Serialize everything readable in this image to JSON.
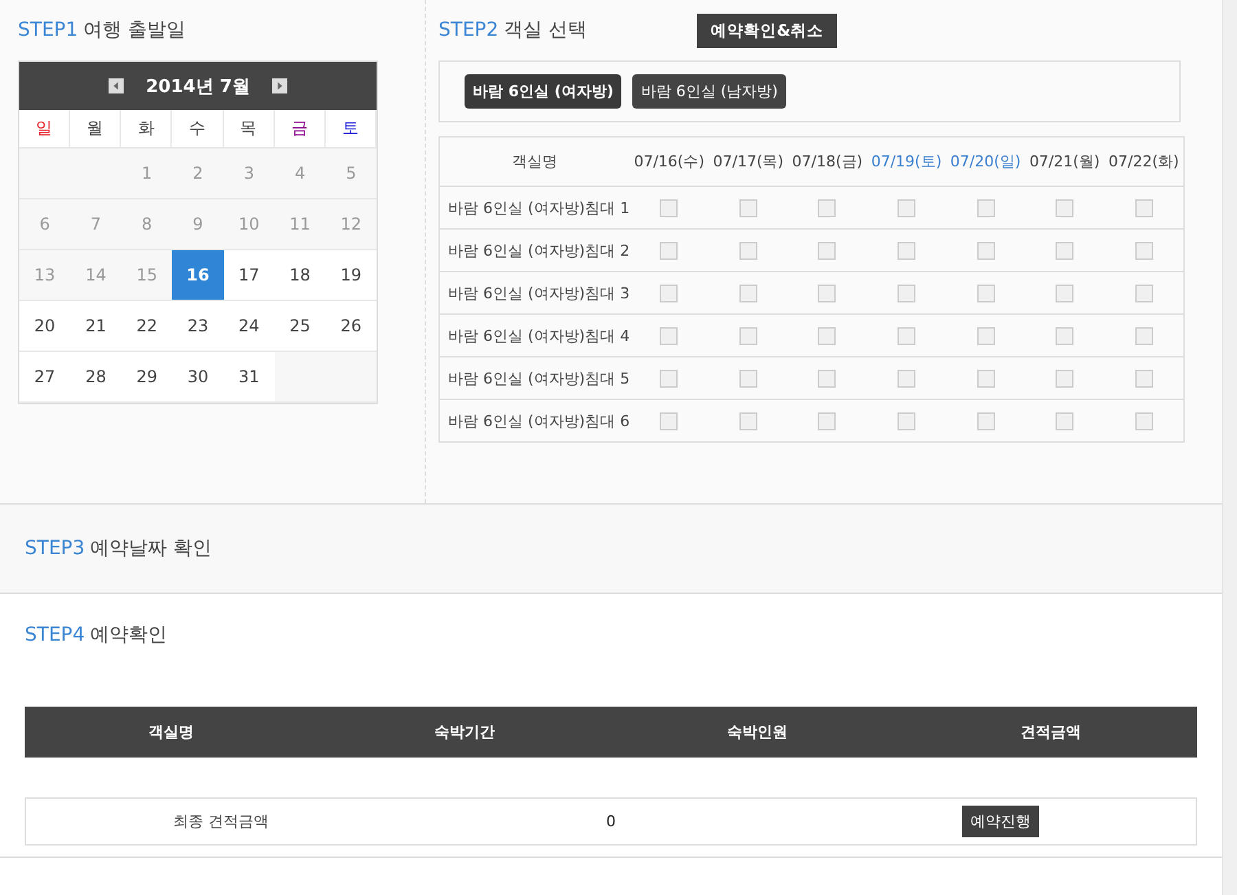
{
  "step1": {
    "step": "STEP1",
    "title": "여행 출발일",
    "calendar": {
      "month": "2014년 7월",
      "weekdays": [
        {
          "label": "일",
          "color": "#e8202a"
        },
        {
          "label": "월",
          "color": "#444444"
        },
        {
          "label": "화",
          "color": "#444444"
        },
        {
          "label": "수",
          "color": "#444444"
        },
        {
          "label": "목",
          "color": "#444444"
        },
        {
          "label": "금",
          "color": "#8b0a8b"
        },
        {
          "label": "토",
          "color": "#1a1ad8"
        }
      ],
      "weeks": [
        [
          {
            "kind": "blank"
          },
          {
            "kind": "blank"
          },
          {
            "kind": "day",
            "day": "1",
            "disabled": true,
            "selected": false
          },
          {
            "kind": "day",
            "day": "2",
            "disabled": true,
            "selected": false
          },
          {
            "kind": "day",
            "day": "3",
            "disabled": true,
            "selected": false
          },
          {
            "kind": "day",
            "day": "4",
            "disabled": true,
            "selected": false
          },
          {
            "kind": "day",
            "day": "5",
            "disabled": true,
            "selected": false
          }
        ],
        [
          {
            "kind": "day",
            "day": "6",
            "disabled": true,
            "selected": false
          },
          {
            "kind": "day",
            "day": "7",
            "disabled": true,
            "selected": false
          },
          {
            "kind": "day",
            "day": "8",
            "disabled": true,
            "selected": false
          },
          {
            "kind": "day",
            "day": "9",
            "disabled": true,
            "selected": false
          },
          {
            "kind": "day",
            "day": "10",
            "disabled": true,
            "selected": false
          },
          {
            "kind": "day",
            "day": "11",
            "disabled": true,
            "selected": false
          },
          {
            "kind": "day",
            "day": "12",
            "disabled": true,
            "selected": false
          }
        ],
        [
          {
            "kind": "day",
            "day": "13",
            "disabled": true,
            "selected": false
          },
          {
            "kind": "day",
            "day": "14",
            "disabled": true,
            "selected": false
          },
          {
            "kind": "day",
            "day": "15",
            "disabled": true,
            "selected": false
          },
          {
            "kind": "day",
            "day": "16",
            "disabled": false,
            "selected": true
          },
          {
            "kind": "day",
            "day": "17",
            "disabled": false,
            "selected": false
          },
          {
            "kind": "day",
            "day": "18",
            "disabled": false,
            "selected": false
          },
          {
            "kind": "day",
            "day": "19",
            "disabled": false,
            "selected": false
          }
        ],
        [
          {
            "kind": "day",
            "day": "20",
            "disabled": false,
            "selected": false
          },
          {
            "kind": "day",
            "day": "21",
            "disabled": false,
            "selected": false
          },
          {
            "kind": "day",
            "day": "22",
            "disabled": false,
            "selected": false
          },
          {
            "kind": "day",
            "day": "23",
            "disabled": false,
            "selected": false
          },
          {
            "kind": "day",
            "day": "24",
            "disabled": false,
            "selected": false
          },
          {
            "kind": "day",
            "day": "25",
            "disabled": false,
            "selected": false
          },
          {
            "kind": "day",
            "day": "26",
            "disabled": false,
            "selected": false
          }
        ],
        [
          {
            "kind": "day",
            "day": "27",
            "disabled": false,
            "selected": false
          },
          {
            "kind": "day",
            "day": "28",
            "disabled": false,
            "selected": false
          },
          {
            "kind": "day",
            "day": "29",
            "disabled": false,
            "selected": false
          },
          {
            "kind": "day",
            "day": "30",
            "disabled": false,
            "selected": false
          },
          {
            "kind": "day",
            "day": "31",
            "disabled": false,
            "selected": false
          },
          {
            "kind": "blank"
          },
          {
            "kind": "blank"
          }
        ]
      ]
    }
  },
  "step2": {
    "step": "STEP2",
    "title": "객실 선택",
    "confirm_cancel_button": "예약확인&취소",
    "room_tabs": [
      {
        "label": "바람 6인실 (여자방)",
        "selected": true
      },
      {
        "label": "바람 6인실 (남자방)",
        "selected": false
      }
    ],
    "table": {
      "name_column": "객실명",
      "date_columns": [
        {
          "label": "07/16(수)",
          "color": "#444444"
        },
        {
          "label": "07/17(목)",
          "color": "#444444"
        },
        {
          "label": "07/18(금)",
          "color": "#444444"
        },
        {
          "label": "07/19(토)",
          "color": "#3a7fd0"
        },
        {
          "label": "07/20(일)",
          "color": "#3a7fd0"
        },
        {
          "label": "07/21(월)",
          "color": "#444444"
        },
        {
          "label": "07/22(화)",
          "color": "#444444"
        }
      ],
      "rows": [
        {
          "name": "바람 6인실 (여자방)침대 1",
          "checks": [
            {
              "checked": false
            },
            {
              "checked": false
            },
            {
              "checked": false
            },
            {
              "checked": false
            },
            {
              "checked": false
            },
            {
              "checked": false
            },
            {
              "checked": false
            }
          ]
        },
        {
          "name": "바람 6인실 (여자방)침대 2",
          "checks": [
            {
              "checked": false
            },
            {
              "checked": false
            },
            {
              "checked": false
            },
            {
              "checked": false
            },
            {
              "checked": false
            },
            {
              "checked": false
            },
            {
              "checked": false
            }
          ]
        },
        {
          "name": "바람 6인실 (여자방)침대 3",
          "checks": [
            {
              "checked": false
            },
            {
              "checked": false
            },
            {
              "checked": false
            },
            {
              "checked": false
            },
            {
              "checked": false
            },
            {
              "checked": false
            },
            {
              "checked": false
            }
          ]
        },
        {
          "name": "바람 6인실 (여자방)침대 4",
          "checks": [
            {
              "checked": false
            },
            {
              "checked": false
            },
            {
              "checked": false
            },
            {
              "checked": false
            },
            {
              "checked": false
            },
            {
              "checked": false
            },
            {
              "checked": false
            }
          ]
        },
        {
          "name": "바람 6인실 (여자방)침대 5",
          "checks": [
            {
              "checked": false
            },
            {
              "checked": false
            },
            {
              "checked": false
            },
            {
              "checked": false
            },
            {
              "checked": false
            },
            {
              "checked": false
            },
            {
              "checked": false
            }
          ]
        },
        {
          "name": "바람 6인실 (여자방)침대 6",
          "checks": [
            {
              "checked": false
            },
            {
              "checked": false
            },
            {
              "checked": false
            },
            {
              "checked": false
            },
            {
              "checked": false
            },
            {
              "checked": false
            },
            {
              "checked": false
            }
          ]
        }
      ]
    }
  },
  "step3": {
    "step": "STEP3",
    "title": "예약날짜 확인"
  },
  "step4": {
    "step": "STEP4",
    "title": "예약확인",
    "columns": [
      "객실명",
      "숙박기간",
      "숙박인원",
      "견적금액"
    ],
    "total": {
      "label": "최종 견적금액",
      "amount": "0",
      "button": "예약진행"
    }
  }
}
